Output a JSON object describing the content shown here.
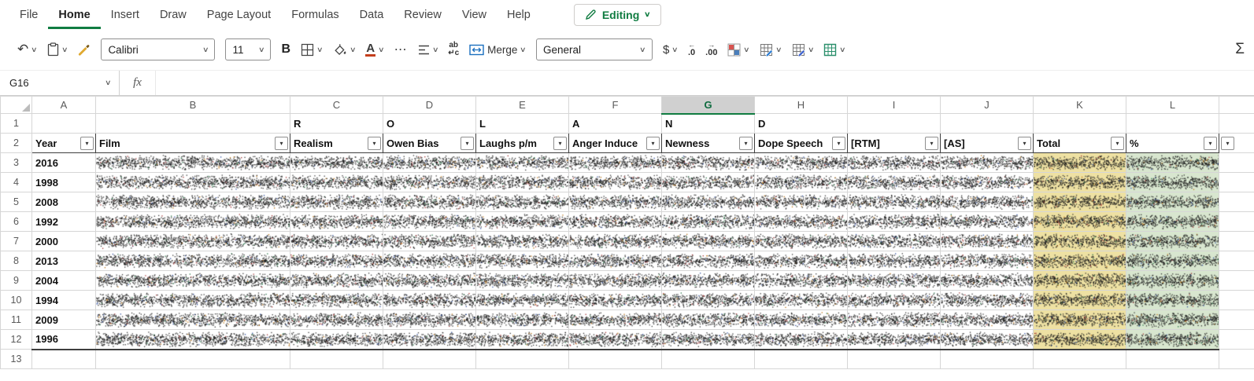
{
  "colors": {
    "accent_green": "#107C41",
    "font_color_underline": "#c43e1c",
    "total_column_fill": "#eee1a3",
    "percent_column_fill": "#d8e6cf",
    "selected_header_bg": "#d0d0d0"
  },
  "menu": {
    "items": [
      "File",
      "Home",
      "Insert",
      "Draw",
      "Page Layout",
      "Formulas",
      "Data",
      "Review",
      "View",
      "Help"
    ],
    "active_item": "Home",
    "editing_label": "Editing"
  },
  "toolbar": {
    "font_name": "Calibri",
    "font_size": "11",
    "merge_label": "Merge",
    "number_format": "General"
  },
  "formula_bar": {
    "name_box": "G16",
    "fx_label": "fx",
    "formula": ""
  },
  "icons": {
    "chevron": "∨",
    "filter": "▾",
    "undo": "↶",
    "more": "⋯",
    "sum": "Σ",
    "dollar": "$",
    "bold": "B",
    "font_color_letter": "A",
    "wrap_top": "ab",
    "wrap_bottom": "↵c",
    "dec_arrow": "←",
    "dec_text": ".0",
    "inc_arrow": "→",
    "inc_text": ".00"
  },
  "grid": {
    "col_letters": [
      "A",
      "B",
      "C",
      "D",
      "E",
      "F",
      "G",
      "H",
      "I",
      "J",
      "K",
      "L"
    ],
    "selected_column": "G",
    "row_numbers": [
      "1",
      "2",
      "3",
      "4",
      "5",
      "6",
      "7",
      "8",
      "9",
      "10",
      "11",
      "12",
      "13"
    ],
    "spell_row": [
      "R",
      "O",
      "L",
      "A",
      "N",
      "D"
    ],
    "table_headers": [
      "Year",
      "Film",
      "Realism",
      "Owen Bias",
      "Laughs p/m",
      "Anger Induce",
      "Newness",
      "Dope Speech",
      "[RTM]",
      "[AS]",
      "Total",
      "%"
    ],
    "years": [
      "2016",
      "1998",
      "2008",
      "1992",
      "2000",
      "2013",
      "2004",
      "1994",
      "2009",
      "1996"
    ]
  }
}
